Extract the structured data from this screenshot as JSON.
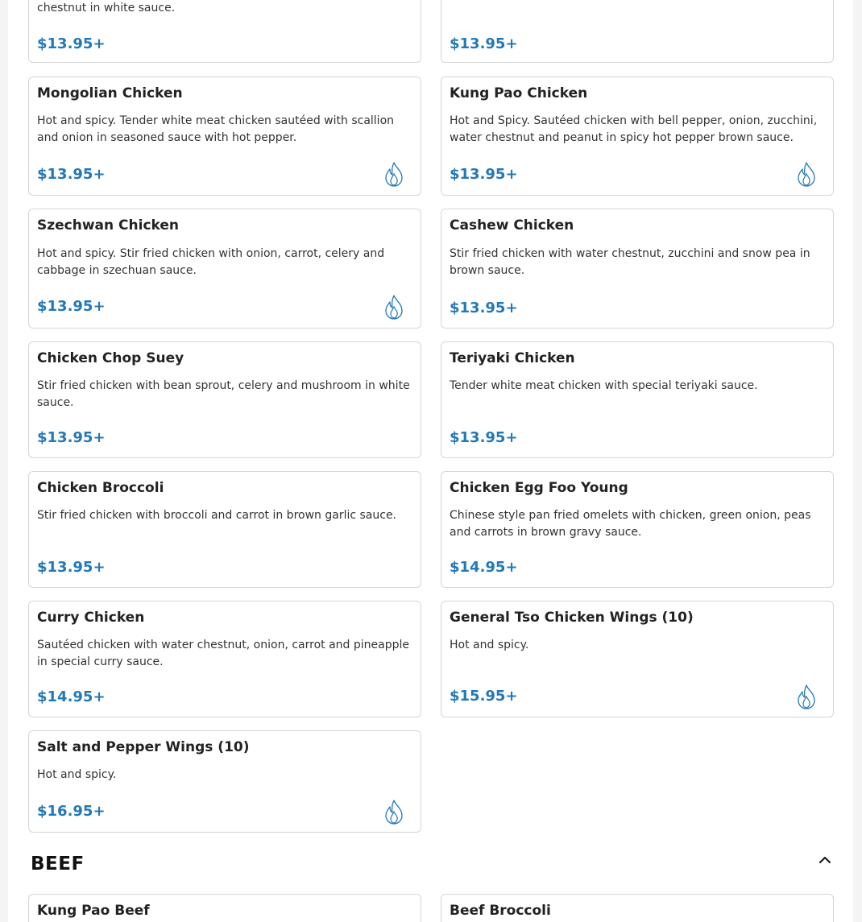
{
  "colors": {
    "accent": "#2378b8",
    "border": "#d6d6d6",
    "heading": "#111111"
  },
  "items": [
    {
      "desc": "chestnut in white sauce.",
      "price": "$13.95+"
    },
    {
      "price": "$13.95+"
    },
    {
      "title": "Mongolian Chicken",
      "desc": "Hot and spicy. Tender white meat chicken sautéed with scallion and onion in seasoned sauce with hot pepper.",
      "price": "$13.95+",
      "spicy": true
    },
    {
      "title": "Kung Pao Chicken",
      "desc": "Hot and Spicy. Sautéed chicken with bell pepper, onion, zucchini, water chestnut and peanut in spicy hot pepper brown sauce.",
      "price": "$13.95+",
      "spicy": true
    },
    {
      "title": "Szechwan Chicken",
      "desc": "Hot and spicy. Stir fried chicken with onion, carrot, celery and cabbage in szechuan sauce.",
      "price": "$13.95+",
      "spicy": true
    },
    {
      "title": "Cashew Chicken",
      "desc": "Stir fried chicken with water chestnut, zucchini and snow pea in brown sauce.",
      "price": "$13.95+"
    },
    {
      "title": "Chicken Chop Suey",
      "desc": "Stir fried chicken with bean sprout, celery and mushroom in white sauce.",
      "price": "$13.95+"
    },
    {
      "title": "Teriyaki Chicken",
      "desc": "Tender white meat chicken with special teriyaki sauce.",
      "price": "$13.95+"
    },
    {
      "title": "Chicken Broccoli",
      "desc": "Stir fried chicken with broccoli and carrot in brown garlic sauce.",
      "price": "$13.95+"
    },
    {
      "title": "Chicken Egg Foo Young",
      "desc": "Chinese style pan fried omelets with chicken, green onion, peas and carrots in brown gravy sauce.",
      "price": "$14.95+"
    },
    {
      "title": "Curry Chicken",
      "desc": "Sautéed chicken with water chestnut, onion, carrot and pineapple in special curry sauce.",
      "price": "$14.95+"
    },
    {
      "title": "General Tso Chicken Wings (10)",
      "desc": "Hot and spicy.",
      "price": "$15.95+",
      "spicy": true
    },
    {
      "title": "Salt and Pepper Wings (10)",
      "desc": "Hot and spicy.",
      "price": "$16.95+",
      "spicy": true
    }
  ],
  "beef_section": {
    "title": "BEEF",
    "collapse_icon": "chevron-up-icon",
    "items": [
      {
        "title": "Kung Pao Beef"
      },
      {
        "title": "Beef Broccoli"
      }
    ]
  },
  "icons": {
    "spicy": "flame-icon"
  }
}
